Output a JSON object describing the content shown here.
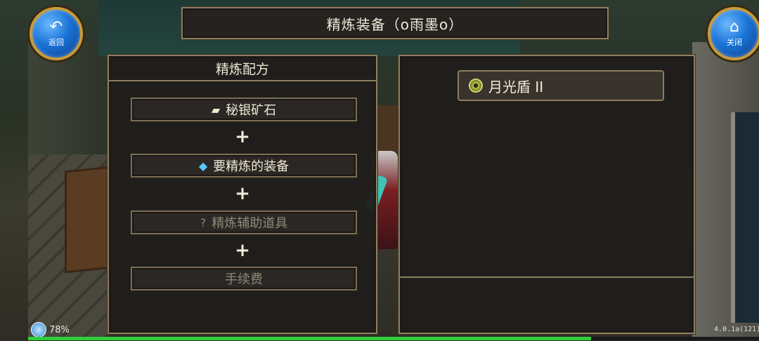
{
  "header": {
    "title": "精炼装备（o雨墨o）"
  },
  "nav": {
    "back_label": "返回",
    "close_label": "关闭"
  },
  "recipe_panel": {
    "title": "精炼配方",
    "slots": [
      {
        "label": "秘银矿石",
        "icon": "ore-icon",
        "state": "filled"
      },
      {
        "label": "要精炼的装备",
        "icon": "equipment-icon",
        "state": "filled"
      },
      {
        "label": "精炼辅助道具",
        "icon": "question-icon",
        "state": "empty"
      },
      {
        "label": "手续费",
        "icon": "",
        "state": "empty"
      }
    ],
    "plus_symbol": "+"
  },
  "equipment_list": {
    "items": [
      {
        "name": "月光盾 II",
        "icon": "shield-ring-icon"
      }
    ]
  },
  "status": {
    "battery": "78%",
    "version": "4.0.1a(121)",
    "progress": 0.77
  },
  "colors": {
    "frame": "#8d7e60",
    "progress": "#2fcf3a",
    "button": "#1a73d6"
  }
}
